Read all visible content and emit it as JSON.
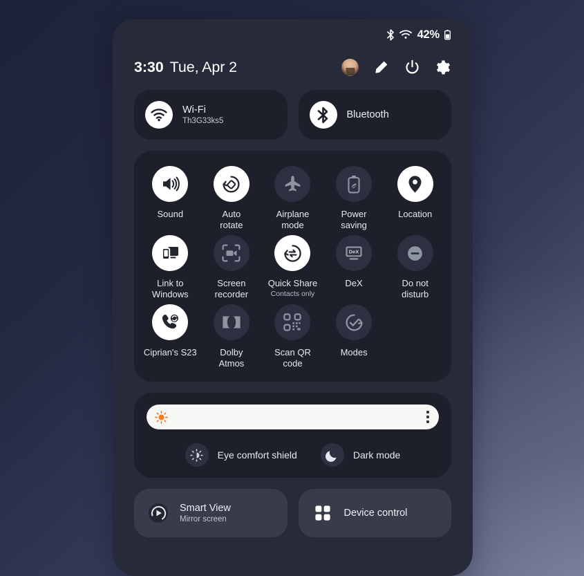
{
  "status_bar": {
    "bluetooth_icon": "bluetooth-icon",
    "wifi_icon": "wifi-icon",
    "battery_percent": "42%",
    "battery_icon": "battery-icon"
  },
  "header": {
    "time": "3:30",
    "date": "Tue, Apr 2",
    "actions": [
      {
        "name": "user-avatar",
        "icon": "avatar-icon"
      },
      {
        "name": "edit-button",
        "icon": "pencil-icon"
      },
      {
        "name": "power-button",
        "icon": "power-icon"
      },
      {
        "name": "settings-button",
        "icon": "gear-icon"
      }
    ]
  },
  "connectivity": [
    {
      "title": "Wi-Fi",
      "sub": "Th3G33ks5",
      "icon": "wifi-icon",
      "state": "on"
    },
    {
      "title": "Bluetooth",
      "sub": "",
      "icon": "bluetooth-icon",
      "state": "on"
    }
  ],
  "toggles": [
    [
      {
        "label": "Sound",
        "sub": "",
        "icon": "speaker-icon",
        "state": "on"
      },
      {
        "label": "Auto\nrotate",
        "sub": "",
        "icon": "auto-rotate-icon",
        "state": "on"
      },
      {
        "label": "Airplane\nmode",
        "sub": "",
        "icon": "airplane-icon",
        "state": "off"
      },
      {
        "label": "Power\nsaving",
        "sub": "",
        "icon": "battery-leaf-icon",
        "state": "off"
      },
      {
        "label": "Location",
        "sub": "",
        "icon": "location-pin-icon",
        "state": "on"
      }
    ],
    [
      {
        "label": "Link to\nWindows",
        "sub": "",
        "icon": "link-to-windows-icon",
        "state": "on"
      },
      {
        "label": "Screen\nrecorder",
        "sub": "",
        "icon": "screen-recorder-icon",
        "state": "off"
      },
      {
        "label": "Quick Share",
        "sub": "Contacts only",
        "icon": "quick-share-icon",
        "state": "on"
      },
      {
        "label": "DeX",
        "sub": "",
        "icon": "dex-icon",
        "state": "off"
      },
      {
        "label": "Do not\ndisturb",
        "sub": "",
        "icon": "do-not-disturb-icon",
        "state": "off"
      }
    ],
    [
      {
        "label": "Ciprian's S23",
        "sub": "",
        "icon": "call-transfer-icon",
        "state": "on"
      },
      {
        "label": "Dolby\nAtmos",
        "sub": "",
        "icon": "dolby-atmos-icon",
        "state": "off"
      },
      {
        "label": "Scan QR\ncode",
        "sub": "",
        "icon": "qr-code-icon",
        "state": "off"
      },
      {
        "label": "Modes",
        "sub": "",
        "icon": "modes-icon",
        "state": "off"
      }
    ]
  ],
  "brightness": {
    "icon": "brightness-sun-icon",
    "value_percent": 96,
    "menu_icon": "more-options-icon"
  },
  "display_modes": [
    {
      "label": "Eye comfort shield",
      "icon": "eye-comfort-icon",
      "state": "off"
    },
    {
      "label": "Dark mode",
      "icon": "moon-icon",
      "state": "off"
    }
  ],
  "bottom_tiles": [
    {
      "title": "Smart View",
      "sub": "Mirror screen",
      "icon": "smart-view-icon"
    },
    {
      "title": "Device control",
      "sub": "",
      "icon": "device-control-icon"
    }
  ],
  "colors": {
    "panel_bg": "#272b39",
    "card_bg": "#1d1f2b",
    "tile_bg": "#383c4a",
    "toggle_on": "#ffffff",
    "toggle_off": "#2c3040",
    "slider_track": "#f7f7f5",
    "brightness_accent": "#f57c29",
    "text_primary": "#eceef3",
    "text_secondary": "#c3c7d2"
  }
}
